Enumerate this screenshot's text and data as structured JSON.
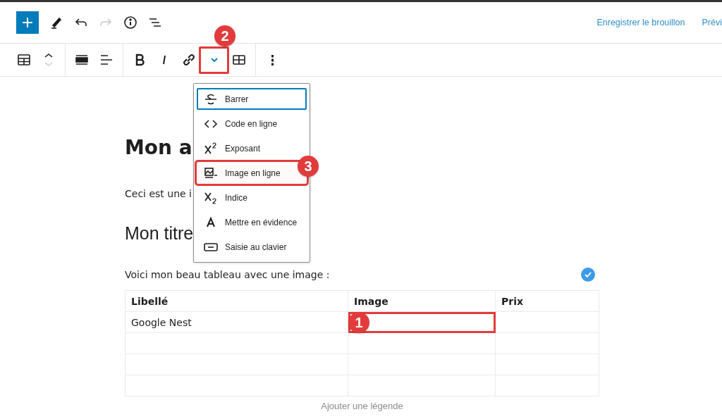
{
  "top_bar": {
    "actions": [
      {
        "kind": "pen",
        "disabled": false
      },
      {
        "kind": "undo",
        "disabled": false
      },
      {
        "kind": "redo",
        "disabled": true
      },
      {
        "kind": "info",
        "disabled": false
      },
      {
        "kind": "list",
        "disabled": false
      }
    ],
    "save_draft": "Enregistrer le brouillon",
    "preview": "Prévi"
  },
  "block_toolbar": {
    "groups": [
      {
        "items": [
          {
            "kind": "table",
            "highlighted": false
          },
          {
            "kind": "move",
            "highlighted": false
          }
        ]
      },
      {
        "items": [
          {
            "kind": "align-wide",
            "highlighted": false
          },
          {
            "kind": "align-left",
            "highlighted": false
          }
        ]
      },
      {
        "items": [
          {
            "kind": "bold",
            "highlighted": false
          },
          {
            "kind": "italic",
            "highlighted": false
          },
          {
            "kind": "link",
            "highlighted": false
          },
          {
            "kind": "more-formats",
            "highlighted": true
          },
          {
            "kind": "edit-table",
            "highlighted": false
          }
        ]
      },
      {
        "items": [
          {
            "kind": "options",
            "highlighted": false
          }
        ]
      }
    ],
    "callout": "2"
  },
  "format_menu": {
    "items": [
      {
        "kind": "strike",
        "label": "Barrer",
        "selected": true,
        "highlighted": false
      },
      {
        "kind": "code",
        "label": "Code en ligne",
        "selected": false,
        "highlighted": false
      },
      {
        "kind": "sup",
        "label": "Exposant",
        "selected": false,
        "highlighted": false
      },
      {
        "kind": "image",
        "label": "Image en ligne",
        "selected": false,
        "highlighted": true
      },
      {
        "kind": "sub",
        "label": "Indice",
        "selected": false,
        "highlighted": false
      },
      {
        "kind": "mark",
        "label": "Mettre en évidence",
        "selected": false,
        "highlighted": false
      },
      {
        "kind": "keyboard",
        "label": "Saisie au clavier",
        "selected": false,
        "highlighted": false
      }
    ],
    "callout": "3"
  },
  "content": {
    "title": "Mon a",
    "paragraph": "Ceci est une i",
    "heading": "Mon titre",
    "intro": "Voici mon beau tableau avec une image :",
    "table": {
      "columns": [
        "Libellé",
        "Image",
        "Prix"
      ],
      "rows": [
        {
          "cells": [
            {
              "text": "Google Nest",
              "highlighted": false
            },
            {
              "highlighted": true
            },
            {
              "highlighted": false
            }
          ]
        },
        {
          "cells": [
            {
              "highlighted": false
            },
            {
              "highlighted": false
            },
            {
              "highlighted": false
            }
          ]
        },
        {
          "cells": [
            {
              "highlighted": false
            },
            {
              "highlighted": false
            },
            {
              "highlighted": false
            }
          ]
        },
        {
          "cells": [
            {
              "highlighted": false
            },
            {
              "highlighted": false
            },
            {
              "highlighted": false
            }
          ]
        }
      ],
      "callout": "1"
    },
    "caption_placeholder": "Ajouter une légende"
  }
}
